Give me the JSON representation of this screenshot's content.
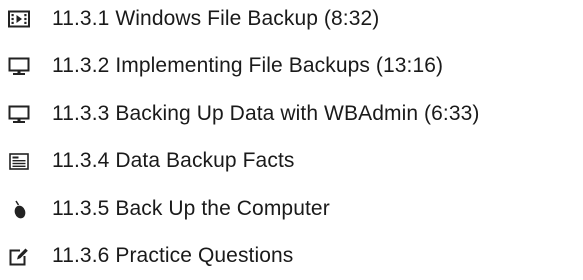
{
  "lessons": [
    {
      "label": "11.3.1 Windows File Backup (8:32)",
      "icon": "video-icon"
    },
    {
      "label": "11.3.2 Implementing File Backups (13:16)",
      "icon": "monitor-icon"
    },
    {
      "label": "11.3.3 Backing Up Data with WBAdmin (6:33)",
      "icon": "monitor-icon"
    },
    {
      "label": "11.3.4 Data Backup Facts",
      "icon": "document-icon"
    },
    {
      "label": "11.3.5 Back Up the Computer",
      "icon": "mouse-icon"
    },
    {
      "label": "11.3.6 Practice Questions",
      "icon": "edit-icon"
    }
  ]
}
